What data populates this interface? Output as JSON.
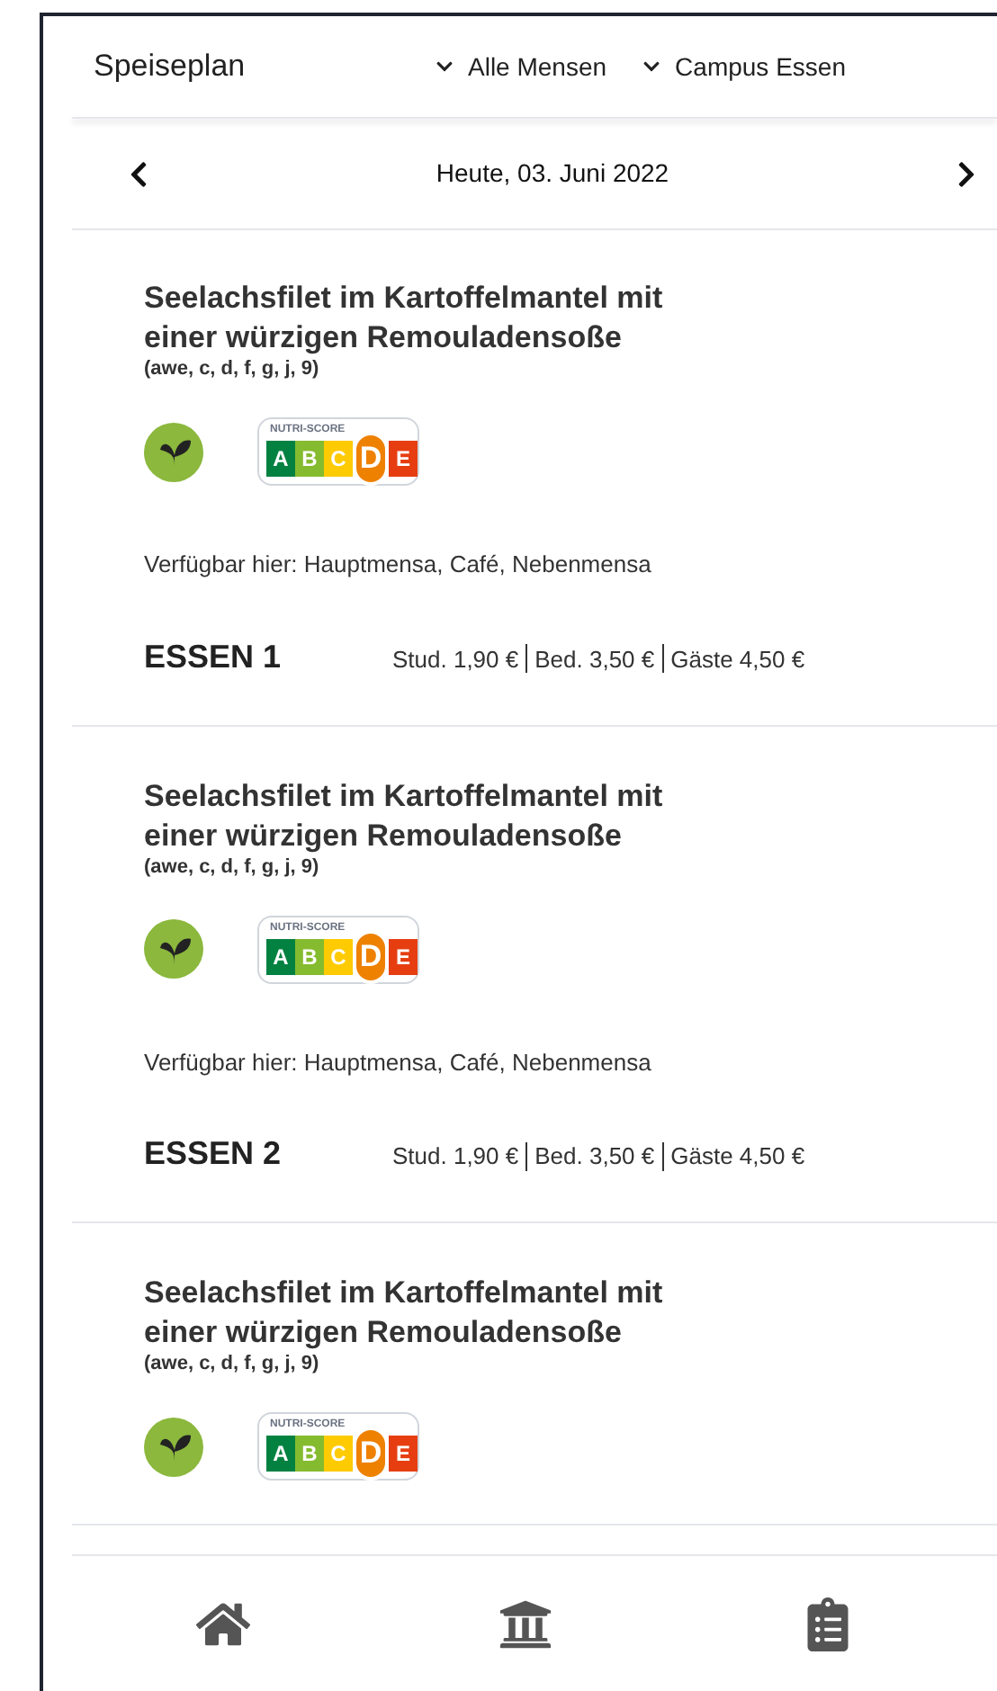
{
  "header": {
    "title": "Speiseplan",
    "filters": [
      "Alle Mensen",
      "Campus Essen"
    ]
  },
  "date_nav": {
    "label": "Heute, 03. Juni 2022"
  },
  "meals": [
    {
      "title": "Seelachsfilet im Kartoffelmantel mit einer würzigen Remouladensoße",
      "allergens": "(awe, c, d, f, g, j, 9)",
      "vegetarian": true,
      "nutri_score": {
        "label": "NUTRI-SCORE",
        "grades": [
          {
            "letter": "A",
            "selected": false
          },
          {
            "letter": "B",
            "selected": false
          },
          {
            "letter": "C",
            "selected": false
          },
          {
            "letter": "D",
            "selected": true
          },
          {
            "letter": "E",
            "selected": false
          }
        ]
      },
      "availability": "Verfügbar hier: Hauptmensa, Café, Nebenmensa",
      "name": "ESSEN 1",
      "prices": [
        "Stud. 1,90 €",
        "Bed. 3,50 €",
        "Gäste 4,50 €"
      ]
    },
    {
      "title": "Seelachsfilet im Kartoffelmantel mit einer würzigen Remouladensoße",
      "allergens": "(awe, c, d, f, g, j, 9)",
      "vegetarian": true,
      "nutri_score": {
        "label": "NUTRI-SCORE",
        "grades": [
          {
            "letter": "A",
            "selected": false
          },
          {
            "letter": "B",
            "selected": false
          },
          {
            "letter": "C",
            "selected": false
          },
          {
            "letter": "D",
            "selected": true
          },
          {
            "letter": "E",
            "selected": false
          }
        ]
      },
      "availability": "Verfügbar hier: Hauptmensa, Café, Nebenmensa",
      "name": "ESSEN 2",
      "prices": [
        "Stud. 1,90 €",
        "Bed. 3,50 €",
        "Gäste 4,50 €"
      ]
    },
    {
      "title": "Seelachsfilet im Kartoffelmantel mit einer würzigen Remouladensoße",
      "allergens": "(awe, c, d, f, g, j, 9)",
      "vegetarian": true,
      "nutri_score": {
        "label": "NUTRI-SCORE",
        "grades": [
          {
            "letter": "A",
            "selected": false
          },
          {
            "letter": "B",
            "selected": false
          },
          {
            "letter": "C",
            "selected": false
          },
          {
            "letter": "D",
            "selected": true
          },
          {
            "letter": "E",
            "selected": false
          }
        ]
      }
    }
  ],
  "bottom_nav": [
    {
      "kind": "home",
      "selected": false
    },
    {
      "kind": "institution",
      "selected": false
    },
    {
      "kind": "list",
      "selected": false
    }
  ]
}
